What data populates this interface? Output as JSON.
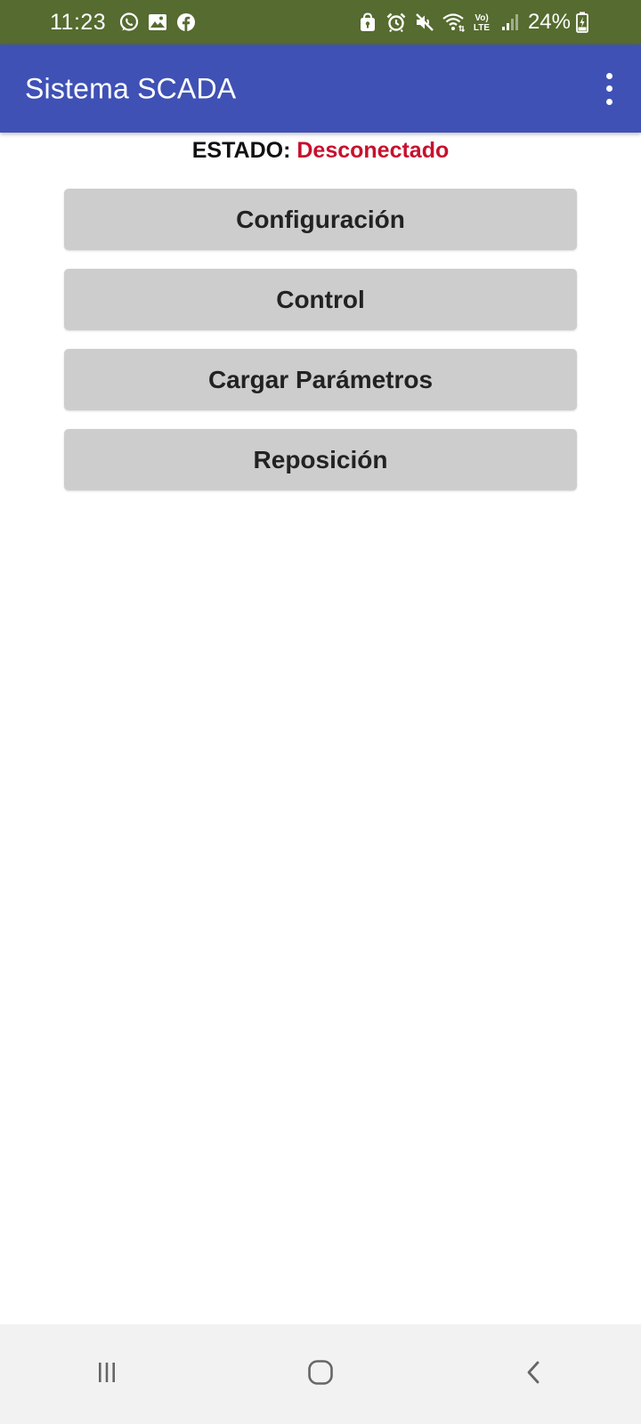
{
  "status_bar": {
    "time": "11:23",
    "battery": "24%",
    "icons_left": [
      "whatsapp-icon",
      "gallery-icon",
      "facebook-icon"
    ],
    "icons_right": [
      "secure-folder-icon",
      "alarm-icon",
      "mute-icon",
      "wifi-icon",
      "volte-icon",
      "signal-icon",
      "battery-charging-icon"
    ],
    "volte_text": "Vo) LTE",
    "background_color": "#556b2f"
  },
  "app_bar": {
    "title": "Sistema SCADA",
    "background_color": "#3f51b5",
    "menu_icon": "more-vert-icon"
  },
  "connection": {
    "label": "ESTADO:",
    "value": "Desconectado",
    "value_color": "#c8102e"
  },
  "menu": {
    "buttons": [
      {
        "label": "Configuración"
      },
      {
        "label": "Control"
      },
      {
        "label": "Cargar Parámetros"
      },
      {
        "label": "Reposición"
      }
    ],
    "button_color": "#cdcdcd"
  },
  "nav_bar": {
    "buttons": [
      "recent-apps-icon",
      "home-icon",
      "back-icon"
    ]
  }
}
